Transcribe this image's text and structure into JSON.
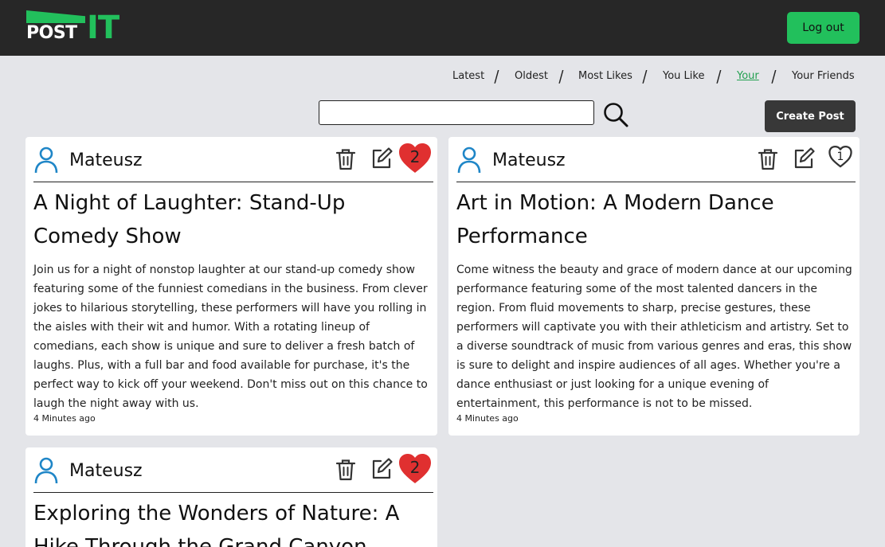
{
  "logo": {
    "part1": "POST",
    "part2": "IT"
  },
  "header": {
    "logout_label": "Log out"
  },
  "nav": {
    "items": [
      {
        "label": "Latest",
        "active": false
      },
      {
        "label": "Oldest",
        "active": false
      },
      {
        "label": "Most Likes",
        "active": false
      },
      {
        "label": "You Like",
        "active": false
      },
      {
        "label": "Your",
        "active": true
      },
      {
        "label": "Your Friends",
        "active": false
      }
    ],
    "separator": "/"
  },
  "search": {
    "value": "",
    "placeholder": ""
  },
  "toolbar": {
    "create_label": "Create Post"
  },
  "colors": {
    "brand": "#22c05c",
    "header_bg": "#272727",
    "heart": "#e03030",
    "user_icon": "#1f86c7"
  },
  "icons": [
    "user-icon",
    "trash-icon",
    "edit-icon",
    "heart-icon",
    "search-icon"
  ],
  "posts": [
    {
      "author": "Mateusz",
      "likes": "2",
      "liked": true,
      "title": "A Night of Laughter: Stand-Up Comedy Show",
      "body": "Join us for a night of nonstop laughter at our stand-up comedy show featuring some of the funniest comedians in the business. From clever jokes to hilarious storytelling, these performers will have you rolling in the aisles with their wit and humor. With a rotating lineup of comedians, each show is unique and sure to deliver a fresh batch of laughs. Plus, with a full bar and food available for purchase, it's the perfect way to kick off your weekend. Don't miss out on this chance to laugh the night away with us.",
      "time": "4 Minutes ago"
    },
    {
      "author": "Mateusz",
      "likes": "1",
      "liked": false,
      "title": "Art in Motion: A Modern Dance Performance",
      "body": "Come witness the beauty and grace of modern dance at our upcoming performance featuring some of the most talented dancers in the region. From fluid movements to sharp, precise gestures, these performers will captivate you with their athleticism and artistry. Set to a diverse soundtrack of music from various genres and eras, this show is sure to delight and inspire audiences of all ages. Whether you're a dance enthusiast or just looking for a unique evening of entertainment, this performance is not to be missed.",
      "time": "4 Minutes ago"
    },
    {
      "author": "Mateusz",
      "likes": "2",
      "liked": true,
      "title": "Exploring the Wonders of Nature: A Hike Through the Grand Canyon",
      "body": "",
      "time": ""
    }
  ]
}
